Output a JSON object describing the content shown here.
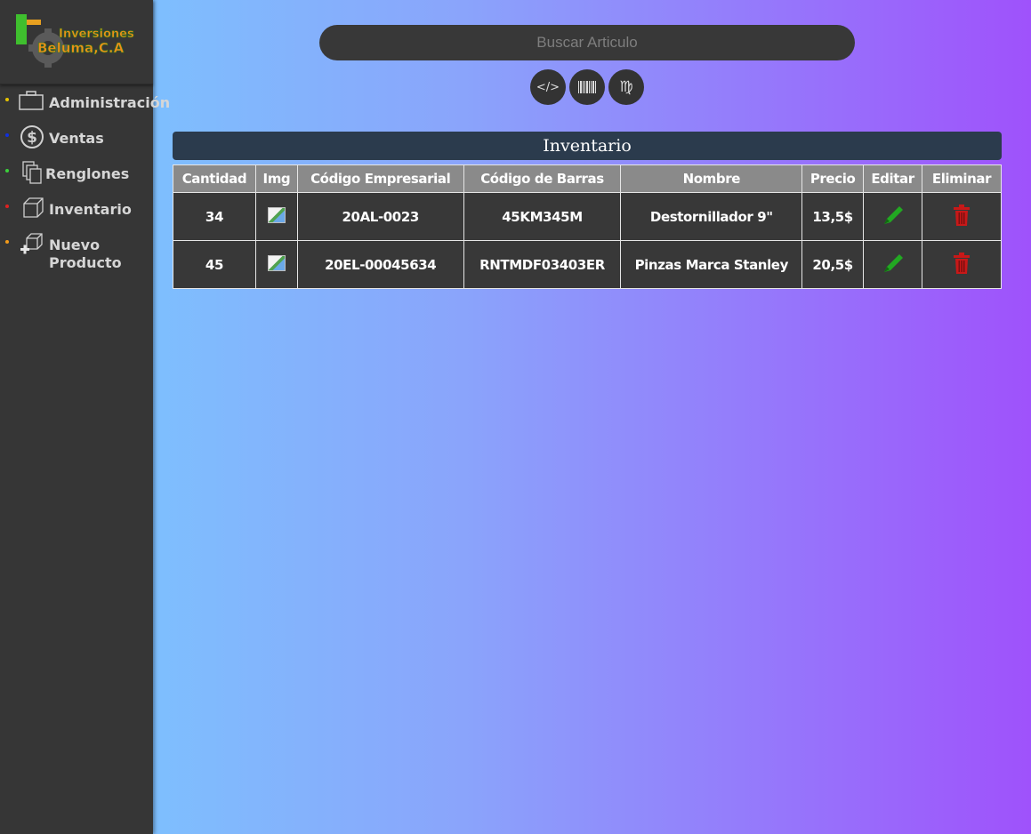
{
  "brand": {
    "line1": "Inversiones",
    "line2": "Beluma,C.A"
  },
  "sidebar": {
    "items": [
      {
        "label": "Administración",
        "icon": "briefcase-icon",
        "bullet": "#e6c300"
      },
      {
        "label": "Ventas",
        "icon": "dollar-icon",
        "bullet": "#1030e0"
      },
      {
        "label": "Renglones",
        "icon": "copy-icon",
        "bullet": "#3bd13b"
      },
      {
        "label": "Inventario",
        "icon": "box-icon",
        "bullet": "#e02020"
      },
      {
        "label": "Nuevo Producto",
        "label_line1": "Nuevo",
        "label_line2": "Producto",
        "icon": "add-box-icon",
        "bullet": "#f29a1a"
      }
    ]
  },
  "search": {
    "placeholder": "Buscar Articulo"
  },
  "buttons": {
    "code_label": "</>",
    "barcode_icon": "barcode-icon",
    "virgo_label": "♍"
  },
  "table": {
    "caption": "Inventario",
    "columns": [
      "Cantidad",
      "Img",
      "Código Empresarial",
      "Código de Barras",
      "Nombre",
      "Precio",
      "Editar",
      "Eliminar"
    ],
    "rows": [
      {
        "cantidad": "34",
        "codigo_empresarial": "20AL-0023",
        "codigo_barras": "45KM345M",
        "nombre": "Destornillador 9\"",
        "precio": "13,5$"
      },
      {
        "cantidad": "45",
        "codigo_empresarial": "20EL-00045634",
        "codigo_barras": "RNTMDF03403ER",
        "nombre": "Pinzas Marca Stanley",
        "precio": "20,5$"
      }
    ]
  },
  "colors": {
    "edit": "#22a822",
    "delete": "#c81818",
    "sidebar_bg": "#363636",
    "caption_bg": "#2b3b4d"
  }
}
